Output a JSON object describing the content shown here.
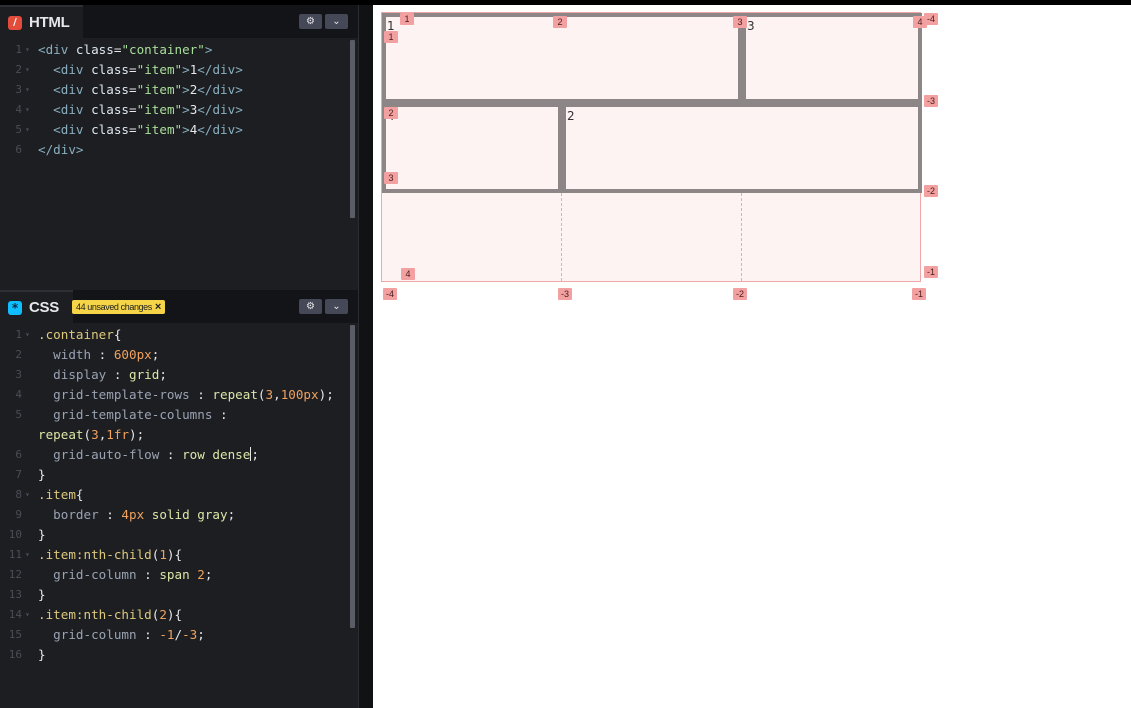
{
  "html_panel": {
    "title": "HTML",
    "lines": [
      {
        "num": "1",
        "fold": true,
        "tokens": [
          [
            "t-tag",
            "<div "
          ],
          [
            "t-attr",
            "class"
          ],
          [
            "t-punc",
            "="
          ],
          [
            "t-str",
            "\"container\""
          ],
          [
            "t-tag",
            ">"
          ]
        ]
      },
      {
        "num": "2",
        "fold": true,
        "tokens": [
          [
            "t-punc",
            "  "
          ],
          [
            "t-tag",
            "<div "
          ],
          [
            "t-attr",
            "class"
          ],
          [
            "t-punc",
            "="
          ],
          [
            "t-str",
            "\"item\""
          ],
          [
            "t-tag",
            ">"
          ],
          [
            "t-punc",
            "1"
          ],
          [
            "t-tag",
            "</div>"
          ]
        ]
      },
      {
        "num": "3",
        "fold": true,
        "tokens": [
          [
            "t-punc",
            "  "
          ],
          [
            "t-tag",
            "<div "
          ],
          [
            "t-attr",
            "class"
          ],
          [
            "t-punc",
            "="
          ],
          [
            "t-str",
            "\"item\""
          ],
          [
            "t-tag",
            ">"
          ],
          [
            "t-punc",
            "2"
          ],
          [
            "t-tag",
            "</div>"
          ]
        ]
      },
      {
        "num": "4",
        "fold": true,
        "tokens": [
          [
            "t-punc",
            "  "
          ],
          [
            "t-tag",
            "<div "
          ],
          [
            "t-attr",
            "class"
          ],
          [
            "t-punc",
            "="
          ],
          [
            "t-str",
            "\"item\""
          ],
          [
            "t-tag",
            ">"
          ],
          [
            "t-punc",
            "3"
          ],
          [
            "t-tag",
            "</div>"
          ]
        ]
      },
      {
        "num": "5",
        "fold": true,
        "tokens": [
          [
            "t-punc",
            "  "
          ],
          [
            "t-tag",
            "<div "
          ],
          [
            "t-attr",
            "class"
          ],
          [
            "t-punc",
            "="
          ],
          [
            "t-str",
            "\"item\""
          ],
          [
            "t-tag",
            ">"
          ],
          [
            "t-punc",
            "4"
          ],
          [
            "t-tag",
            "</div>"
          ]
        ]
      },
      {
        "num": "6",
        "fold": false,
        "tokens": [
          [
            "t-tag",
            "</div>"
          ]
        ]
      }
    ]
  },
  "css_panel": {
    "title": "CSS",
    "unsaved_badge": "44 unsaved changes",
    "lines": [
      {
        "num": "1",
        "fold": true,
        "tokens": [
          [
            "t-sel",
            ".container"
          ],
          [
            "t-punc",
            "{"
          ]
        ]
      },
      {
        "num": "2",
        "fold": false,
        "tokens": [
          [
            "t-punc",
            "  "
          ],
          [
            "t-prop",
            "width"
          ],
          [
            "t-punc",
            " : "
          ],
          [
            "t-num",
            "600px"
          ],
          [
            "t-punc",
            ";"
          ]
        ]
      },
      {
        "num": "3",
        "fold": false,
        "tokens": [
          [
            "t-punc",
            "  "
          ],
          [
            "t-prop",
            "display"
          ],
          [
            "t-punc",
            " : "
          ],
          [
            "t-val",
            "grid"
          ],
          [
            "t-punc",
            ";"
          ]
        ]
      },
      {
        "num": "4",
        "fold": false,
        "tokens": [
          [
            "t-punc",
            "  "
          ],
          [
            "t-prop",
            "grid-template-rows"
          ],
          [
            "t-punc",
            " : "
          ],
          [
            "t-val",
            "repeat"
          ],
          [
            "t-punc",
            "("
          ],
          [
            "t-num",
            "3"
          ],
          [
            "t-punc",
            ","
          ],
          [
            "t-num",
            "100px"
          ],
          [
            "t-punc",
            ");"
          ]
        ]
      },
      {
        "num": "5",
        "fold": false,
        "tokens": [
          [
            "t-punc",
            "  "
          ],
          [
            "t-prop",
            "grid-template-columns"
          ],
          [
            "t-punc",
            " :"
          ]
        ]
      },
      {
        "num": "",
        "fold": false,
        "tokens": [
          [
            "t-val",
            "repeat"
          ],
          [
            "t-punc",
            "("
          ],
          [
            "t-num",
            "3"
          ],
          [
            "t-punc",
            ","
          ],
          [
            "t-num",
            "1fr"
          ],
          [
            "t-punc",
            ");"
          ]
        ]
      },
      {
        "num": "6",
        "fold": false,
        "caret": true,
        "tokens": [
          [
            "t-punc",
            "  "
          ],
          [
            "t-prop",
            "grid-auto-flow"
          ],
          [
            "t-punc",
            " : "
          ],
          [
            "t-val",
            "row dense"
          ],
          [
            "t-punc",
            ";"
          ]
        ]
      },
      {
        "num": "7",
        "fold": false,
        "tokens": [
          [
            "t-punc",
            "}"
          ]
        ]
      },
      {
        "num": "8",
        "fold": true,
        "tokens": [
          [
            "t-sel",
            ".item"
          ],
          [
            "t-punc",
            "{"
          ]
        ]
      },
      {
        "num": "9",
        "fold": false,
        "tokens": [
          [
            "t-punc",
            "  "
          ],
          [
            "t-prop",
            "border"
          ],
          [
            "t-punc",
            " : "
          ],
          [
            "t-num",
            "4px"
          ],
          [
            "t-punc",
            " "
          ],
          [
            "t-val",
            "solid gray"
          ],
          [
            "t-punc",
            ";"
          ]
        ]
      },
      {
        "num": "10",
        "fold": false,
        "tokens": [
          [
            "t-punc",
            "}"
          ]
        ]
      },
      {
        "num": "11",
        "fold": true,
        "tokens": [
          [
            "t-sel",
            ".item:nth-child"
          ],
          [
            "t-punc",
            "("
          ],
          [
            "t-num",
            "1"
          ],
          [
            "t-punc",
            ")"
          ],
          [
            "t-punc",
            "{"
          ]
        ]
      },
      {
        "num": "12",
        "fold": false,
        "tokens": [
          [
            "t-punc",
            "  "
          ],
          [
            "t-prop",
            "grid-column"
          ],
          [
            "t-punc",
            " : "
          ],
          [
            "t-val",
            "span "
          ],
          [
            "t-num",
            "2"
          ],
          [
            "t-punc",
            ";"
          ]
        ]
      },
      {
        "num": "13",
        "fold": false,
        "tokens": [
          [
            "t-punc",
            "}"
          ]
        ]
      },
      {
        "num": "14",
        "fold": true,
        "tokens": [
          [
            "t-sel",
            ".item:nth-child"
          ],
          [
            "t-punc",
            "("
          ],
          [
            "t-num",
            "2"
          ],
          [
            "t-punc",
            ")"
          ],
          [
            "t-punc",
            "{"
          ]
        ]
      },
      {
        "num": "15",
        "fold": false,
        "tokens": [
          [
            "t-punc",
            "  "
          ],
          [
            "t-prop",
            "grid-column"
          ],
          [
            "t-punc",
            " : "
          ],
          [
            "t-num",
            "-1"
          ],
          [
            "t-punc",
            "/"
          ],
          [
            "t-num",
            "-3"
          ],
          [
            "t-punc",
            ";"
          ]
        ]
      },
      {
        "num": "16",
        "fold": false,
        "tokens": [
          [
            "t-punc",
            "}"
          ]
        ]
      }
    ]
  },
  "icons": {
    "html_tab": "html5-icon",
    "css_tab": "css3-icon",
    "settings": "gear-icon",
    "collapse": "chevron-down-icon",
    "badge_close": "close-icon"
  },
  "preview": {
    "items": [
      {
        "label": "1",
        "col_start": 1,
        "col_end": 3,
        "row_start": 1,
        "row_end": 2
      },
      {
        "label": "2",
        "col_start": 2,
        "col_end": 4,
        "row_start": 2,
        "row_end": 3
      },
      {
        "label": "3",
        "col_start": 3,
        "col_end": 4,
        "row_start": 1,
        "row_end": 2
      },
      {
        "label": "4",
        "col_start": 1,
        "col_end": 2,
        "row_start": 2,
        "row_end": 3
      }
    ],
    "line_labels": {
      "top": [
        "2",
        "3",
        "4"
      ],
      "top_first": "1",
      "left": [
        "1",
        "2",
        "3"
      ],
      "bottom_inner": "4",
      "right": [
        "-4",
        "-3",
        "-2",
        "-1"
      ],
      "bottom": [
        "-4",
        "-3",
        "-2",
        "-1"
      ]
    }
  },
  "colors": {
    "editor_bg": "#1d1e22",
    "grid_line": "#f0a7a7",
    "label_bg": "#f2a0a0",
    "badge_bg": "#f5d547"
  }
}
